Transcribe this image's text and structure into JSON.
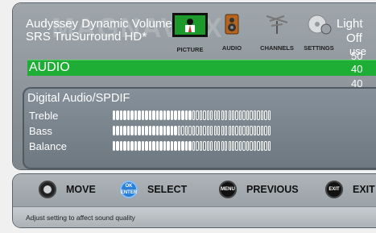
{
  "background": {
    "logo_text": "MAGNAVOX",
    "items": [
      {
        "label": "Audyssey Dynamic Volume",
        "value": "Light"
      },
      {
        "label": "SRS TruSurround HD*",
        "value": "Off"
      }
    ],
    "values_column": [
      "50",
      "40",
      "40"
    ],
    "overlay_value": "use"
  },
  "menu": {
    "tabs": [
      {
        "label": "PICTURE",
        "icon": "tv-icon",
        "active": true
      },
      {
        "label": "AUDIO",
        "icon": "speaker-icon",
        "active": false
      },
      {
        "label": "CHANNELS",
        "icon": "antenna-icon",
        "active": false
      },
      {
        "label": "SETTINGS",
        "icon": "disc-gear-icon",
        "active": false
      }
    ],
    "highlight": "AUDIO"
  },
  "audio": {
    "title": "Digital Audio/SPDIF",
    "rows": [
      {
        "label": "Treble",
        "level": 0.5
      },
      {
        "label": "Bass",
        "level": 0.42
      },
      {
        "label": "Balance",
        "level": 0.5
      }
    ]
  },
  "help": {
    "hints": [
      {
        "icon": "dpad-icon",
        "glyph": "",
        "label": "MOVE"
      },
      {
        "icon": "ok-enter-icon",
        "glyph": "OK ENTER",
        "label": "SELECT"
      },
      {
        "icon": "menu-button-icon",
        "glyph": "MENU",
        "label": "PREVIOUS"
      },
      {
        "icon": "exit-button-icon",
        "glyph": "EXIT",
        "label": "EXIT"
      }
    ],
    "status": "Adjust setting to affect sound quality"
  },
  "colors": {
    "highlight": "#1fae35",
    "panel": "#8a9298",
    "text": "#ffffff"
  }
}
